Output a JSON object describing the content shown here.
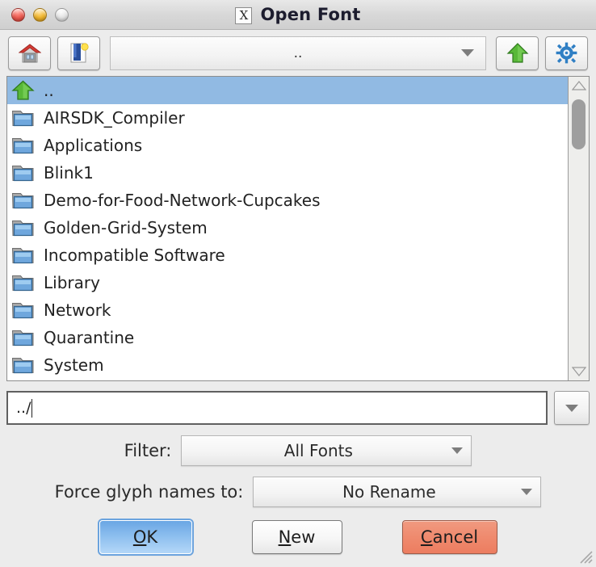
{
  "window": {
    "title": "Open Font",
    "app_icon": "x-glyph-icon",
    "controls": {
      "close": "close-button",
      "minimize": "minimize-button",
      "maximize": "maximize-button"
    }
  },
  "toolbar": {
    "home_button": "home-icon",
    "bookmark_button": "bookmark-icon",
    "path_value": "..",
    "path_dropdown": "chevron-down-icon",
    "up_button": "up-arrow-icon",
    "settings_button": "gear-icon"
  },
  "file_list": {
    "items": [
      {
        "name": "..",
        "icon": "up-arrow-icon",
        "selected": true
      },
      {
        "name": "AIRSDK_Compiler",
        "icon": "folder-icon",
        "selected": false
      },
      {
        "name": "Applications",
        "icon": "folder-icon",
        "selected": false
      },
      {
        "name": "Blink1",
        "icon": "folder-icon",
        "selected": false
      },
      {
        "name": "Demo-for-Food-Network-Cupcakes",
        "icon": "folder-icon",
        "selected": false
      },
      {
        "name": "Golden-Grid-System",
        "icon": "folder-icon",
        "selected": false
      },
      {
        "name": "Incompatible Software",
        "icon": "folder-icon",
        "selected": false
      },
      {
        "name": "Library",
        "icon": "folder-icon",
        "selected": false
      },
      {
        "name": "Network",
        "icon": "folder-icon",
        "selected": false
      },
      {
        "name": "Quarantine",
        "icon": "folder-icon",
        "selected": false
      },
      {
        "name": "System",
        "icon": "folder-icon",
        "selected": false
      }
    ],
    "scrollbar": {
      "up": "scroll-up-icon",
      "down": "scroll-down-icon"
    }
  },
  "filename": {
    "value": "../",
    "dropdown": "chevron-down-icon"
  },
  "filter": {
    "label": "Filter:",
    "value": "All Fonts"
  },
  "glyph_names": {
    "label": "Force glyph names to:",
    "value": "No Rename"
  },
  "buttons": {
    "ok": "OK",
    "ok_mnemonic": "O",
    "ok_rest": "K",
    "new_mnemonic": "N",
    "new_rest": "ew",
    "cancel_mnemonic": "C",
    "cancel_rest": "ancel"
  },
  "colors": {
    "selection": "#91bae3",
    "ok_accent": "#6aa6e4",
    "cancel_accent": "#ef8a6e",
    "window_bg": "#ececec",
    "list_bg": "#ffffff"
  }
}
